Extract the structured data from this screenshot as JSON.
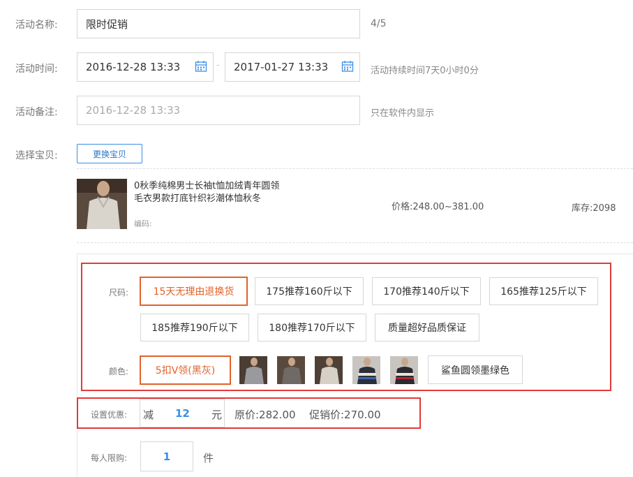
{
  "form": {
    "name_label": "活动名称:",
    "name_value": "限时促销",
    "name_count": "4/5",
    "time_label": "活动时间:",
    "start_time": "2016-12-28 13:33",
    "time_sep": "-",
    "end_time": "2017-01-27 13:33",
    "duration_hint": "活动持续时间7天0小时0分",
    "note_label": "活动备注:",
    "note_placeholder": "2016-12-28 13:33",
    "note_hint": "只在软件内显示",
    "item_label": "选择宝贝:",
    "change_button": "更换宝贝"
  },
  "product": {
    "title_line1": "0秋季纯棉男士长袖t恤加绒青年圆领",
    "title_line2": "毛衣男款打底针织衫潮体恤秋冬",
    "code_label": "编码:",
    "price": "价格:248.00~381.00",
    "stock": "库存:2098"
  },
  "sku": {
    "size_label": "尺码:",
    "sizes": [
      {
        "label": "15天无理由退换货",
        "selected": true
      },
      {
        "label": "175推荐160斤以下",
        "selected": false
      },
      {
        "label": "170推荐140斤以下",
        "selected": false
      },
      {
        "label": "165推荐125斤以下",
        "selected": false
      },
      {
        "label": "185推荐190斤以下",
        "selected": false
      },
      {
        "label": "180推荐170斤以下",
        "selected": false
      },
      {
        "label": "质量超好品质保证",
        "selected": false
      }
    ],
    "color_label": "颜色:",
    "color_selected": "5扣V领(黑灰)",
    "color_last": "鲨鱼圆领墨绿色"
  },
  "discount": {
    "label": "设置优惠:",
    "minus": "减",
    "amount": "12",
    "unit": "元",
    "original": "原价:282.00",
    "promo": "促销价:270.00"
  },
  "limit": {
    "label": "每人限购:",
    "value": "1",
    "unit": "件"
  },
  "colors": {
    "accent_blue": "#3a8ee6",
    "accent_orange": "#e2622a",
    "highlight_red": "#e23a3a"
  }
}
